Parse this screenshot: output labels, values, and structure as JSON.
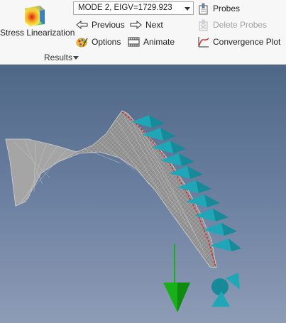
{
  "ribbon": {
    "stress_linearization": {
      "label": "Stress Linearization",
      "icon": "stress-linearization-icon"
    },
    "mode_select": {
      "value": "MODE 2, EIGV=1729.923"
    },
    "previous": {
      "label": "Previous",
      "icon": "arrow-left-icon"
    },
    "next": {
      "label": "Next",
      "icon": "arrow-right-icon"
    },
    "options": {
      "label": "Options",
      "icon": "palette-icon"
    },
    "animate": {
      "label": "Animate",
      "icon": "film-icon"
    },
    "probes": {
      "label": "Probes",
      "icon": "probe-icon"
    },
    "delete_probes": {
      "label": "Delete Probes",
      "icon": "delete-probe-icon",
      "enabled": false
    },
    "convergence_plot": {
      "label": "Convergence Plot",
      "icon": "convergence-plot-icon"
    },
    "group_label": "Results"
  },
  "colors": {
    "ribbon_bg": "#f7f7f7",
    "viewport_top": "#4e6787",
    "viewport_bottom": "#8e9cb6",
    "mesh": "#9a9a9a",
    "constraint": "#1fa7b8",
    "load": "#18b018",
    "edge_highlight": "#e0202a"
  }
}
